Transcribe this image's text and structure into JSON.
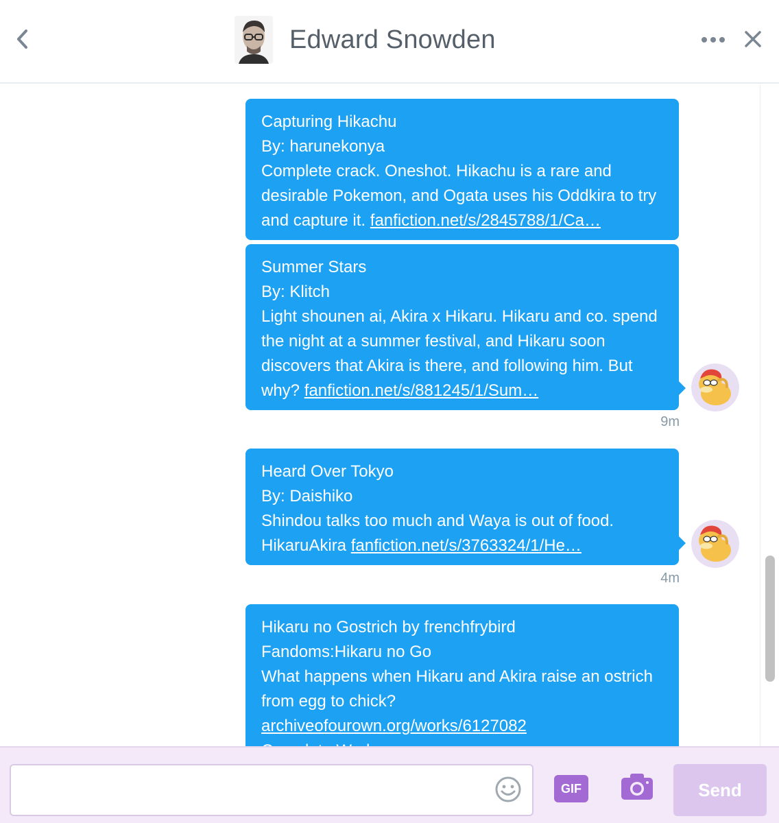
{
  "header": {
    "title": "Edward Snowden"
  },
  "messages": [
    {
      "title": "Capturing Hikachu",
      "author": "By: harunekonya",
      "body_lines": [
        "Complete crack. Oneshot. Hikachu is a rare and",
        "desirable Pokemon, and Ogata uses his Oddkira to try"
      ],
      "last_line_prefix": "and capture it.",
      "link": "fanfiction.net/s/2845788/1/Ca…"
    },
    {
      "title": "Summer Stars",
      "author": "By: Klitch",
      "body_lines": [
        "Light shounen ai, Akira x Hikaru. Hikaru and co. spend",
        "the night at a summer festival, and Hikaru soon",
        "discovers that Akira is there, and following him. But"
      ],
      "last_line_prefix": "why?",
      "link": "fanfiction.net/s/881245/1/Sum…",
      "time": "9m"
    },
    {
      "title": "Heard Over Tokyo",
      "author": "By: Daishiko",
      "body_lines": [
        "Shindou talks too much and Waya is out of food."
      ],
      "last_line_prefix": "HikaruAkira",
      "link": "fanfiction.net/s/3763324/1/He…",
      "time": "4m"
    },
    {
      "title": "Hikaru no Gostrich by frenchfrybird",
      "author": "Fandoms:Hikaru no Go",
      "body_lines": [
        "What happens when Hikaru and Akira raise an ostrich",
        "from egg to chick?"
      ],
      "link": "archiveofourown.org/works/6127082",
      "extra": "Complete Work"
    }
  ],
  "composer": {
    "input_value": "",
    "input_placeholder": "",
    "gif_label": "GIF",
    "send_label": "Send"
  },
  "colors": {
    "bubble": "#1da1f2",
    "composer_bg": "#f3e9f8",
    "accent_purple": "#a46ad3",
    "send_disabled": "#dcc6ee"
  },
  "icons": [
    "back-chevron-icon",
    "more-dots-icon",
    "close-icon",
    "emoji-icon",
    "camera-icon"
  ]
}
